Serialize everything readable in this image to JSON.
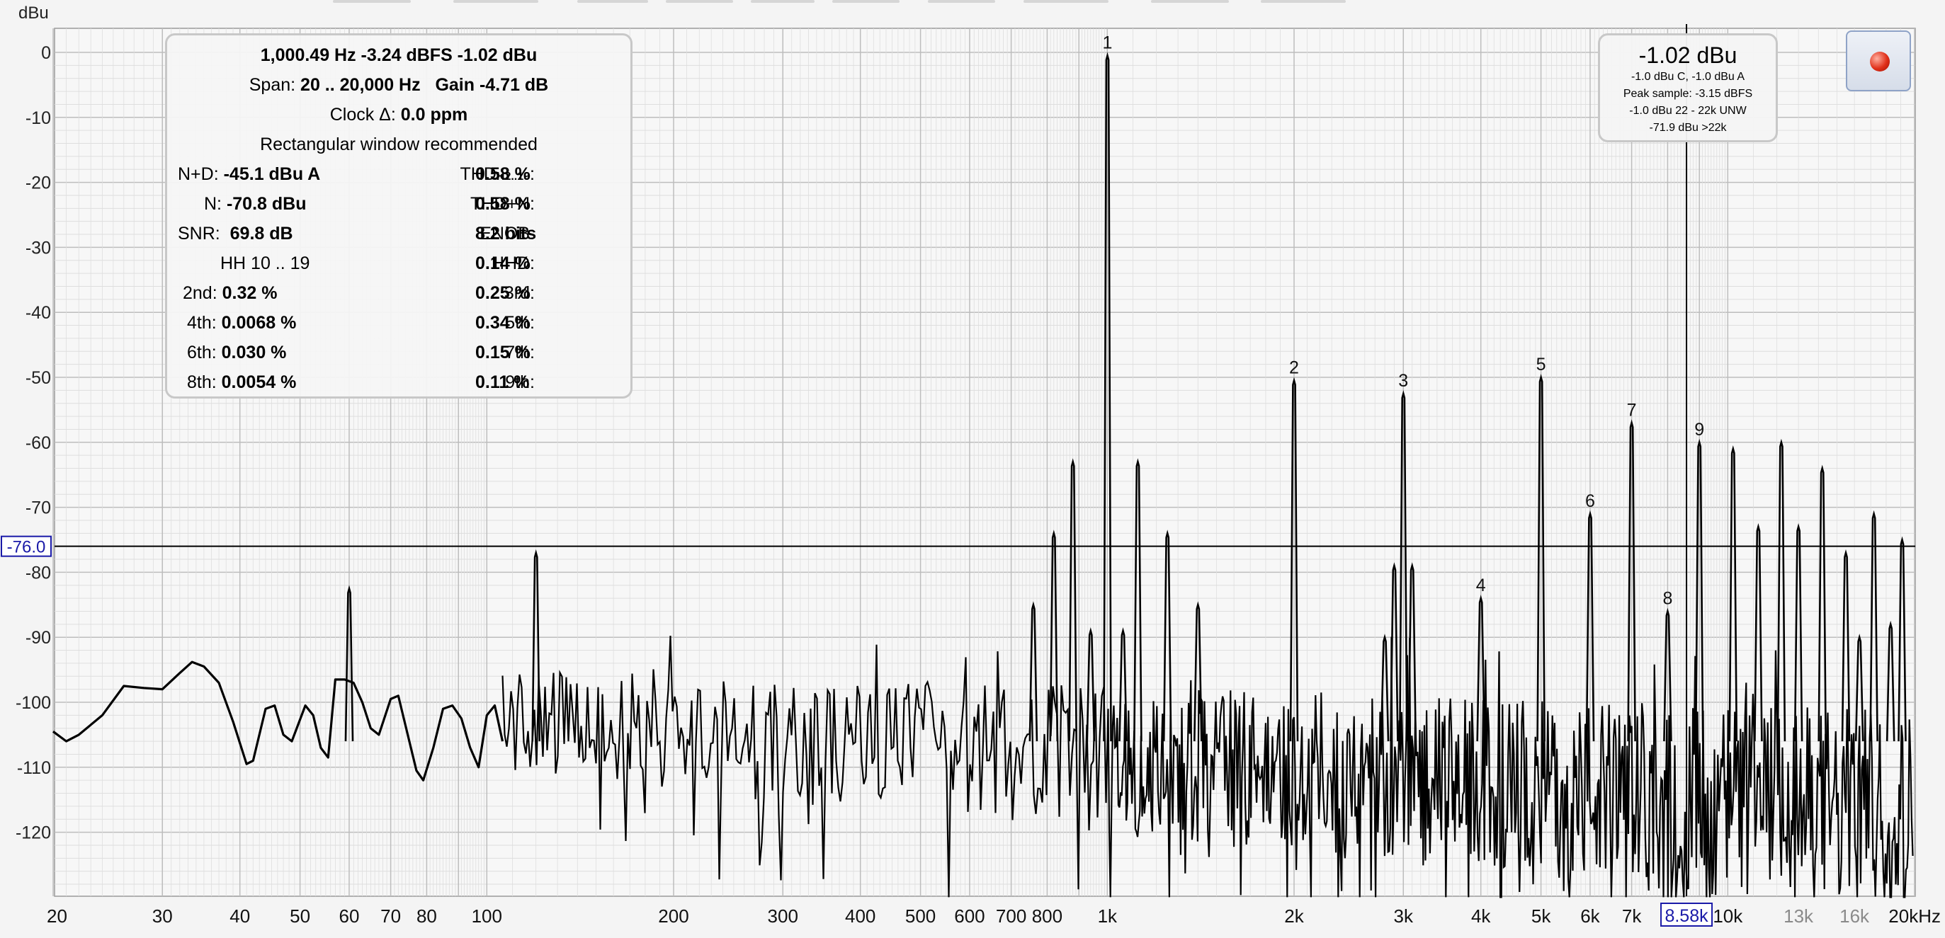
{
  "chart_data": {
    "type": "line",
    "ylabel": "dBu",
    "xscale": "log",
    "xlim": [
      20,
      20000
    ],
    "ylim": [
      -130,
      0
    ],
    "xticks": [
      {
        "v": 20,
        "label": "20"
      },
      {
        "v": 30,
        "label": "30"
      },
      {
        "v": 40,
        "label": "40"
      },
      {
        "v": 50,
        "label": "50"
      },
      {
        "v": 60,
        "label": "60"
      },
      {
        "v": 70,
        "label": "70"
      },
      {
        "v": 80,
        "label": "80"
      },
      {
        "v": 100,
        "label": "100"
      },
      {
        "v": 200,
        "label": "200"
      },
      {
        "v": 300,
        "label": "300"
      },
      {
        "v": 400,
        "label": "400"
      },
      {
        "v": 500,
        "label": "500"
      },
      {
        "v": 600,
        "label": "600"
      },
      {
        "v": 700,
        "label": "700"
      },
      {
        "v": 800,
        "label": "800"
      },
      {
        "v": 1000,
        "label": "1k"
      },
      {
        "v": 2000,
        "label": "2k"
      },
      {
        "v": 3000,
        "label": "3k"
      },
      {
        "v": 4000,
        "label": "4k"
      },
      {
        "v": 5000,
        "label": "5k"
      },
      {
        "v": 6000,
        "label": "6k"
      },
      {
        "v": 7000,
        "label": "7k"
      },
      {
        "v": 10000,
        "label": "10k"
      },
      {
        "v": 13000,
        "label": "13k",
        "dim": true
      },
      {
        "v": 16000,
        "label": "16k",
        "dim": true
      },
      {
        "v": 20000,
        "label": "20kHz"
      }
    ],
    "yticks": [
      0,
      -10,
      -20,
      -30,
      -40,
      -50,
      -60,
      -70,
      -80,
      -90,
      -100,
      -110,
      -120
    ],
    "cursor_x": {
      "v": 8580,
      "label": "8.58k"
    },
    "cursor_y": {
      "v": -76.0,
      "label": "-76.0"
    },
    "harmonics": [
      {
        "n": "1",
        "f": 1000.49,
        "db": -0.5
      },
      {
        "n": "2",
        "f": 2000,
        "db": -50.5
      },
      {
        "n": "3",
        "f": 3000,
        "db": -52.5
      },
      {
        "n": "4",
        "f": 4000,
        "db": -84.0
      },
      {
        "n": "5",
        "f": 5000,
        "db": -50.0
      },
      {
        "n": "6",
        "f": 6000,
        "db": -71.0
      },
      {
        "n": "7",
        "f": 7000,
        "db": -57.0
      },
      {
        "n": "8",
        "f": 8000,
        "db": -86.0
      },
      {
        "n": "9",
        "f": 9000,
        "db": -60.0
      }
    ],
    "spurs": [
      {
        "f": 120,
        "db": -77
      },
      {
        "f": 60,
        "db": -82.5
      },
      {
        "f": 760,
        "db": -85
      },
      {
        "f": 820,
        "db": -74
      },
      {
        "f": 880,
        "db": -63
      },
      {
        "f": 1120,
        "db": -63
      },
      {
        "f": 1250,
        "db": -74
      },
      {
        "f": 1400,
        "db": -85
      },
      {
        "f": 940,
        "db": -89
      },
      {
        "f": 1060,
        "db": -89
      },
      {
        "f": 2900,
        "db": -79
      },
      {
        "f": 3100,
        "db": -79
      },
      {
        "f": 2800,
        "db": -90
      },
      {
        "f": 10200,
        "db": -61
      },
      {
        "f": 11200,
        "db": -73
      },
      {
        "f": 12200,
        "db": -60
      },
      {
        "f": 13000,
        "db": -73
      },
      {
        "f": 14200,
        "db": -64
      },
      {
        "f": 15500,
        "db": -77
      },
      {
        "f": 17200,
        "db": -71
      },
      {
        "f": 19100,
        "db": -75
      },
      {
        "f": 18300,
        "db": -88
      },
      {
        "f": 16300,
        "db": -90
      }
    ],
    "low_curve": [
      [
        20,
        -104.5
      ],
      [
        21,
        -106
      ],
      [
        22,
        -105
      ],
      [
        24,
        -102
      ],
      [
        26,
        -97.5
      ],
      [
        28,
        -97.8
      ],
      [
        30,
        -98
      ],
      [
        32,
        -95.5
      ],
      [
        33.5,
        -93.8
      ],
      [
        35,
        -94.5
      ],
      [
        37,
        -97
      ],
      [
        39,
        -103
      ],
      [
        41,
        -109.5
      ],
      [
        42,
        -109
      ],
      [
        44,
        -101
      ],
      [
        45.5,
        -100.5
      ],
      [
        47,
        -105
      ],
      [
        48.5,
        -106
      ],
      [
        51,
        -100.5
      ],
      [
        52.5,
        -102
      ],
      [
        54,
        -107
      ],
      [
        55.5,
        -108.5
      ],
      [
        57,
        -96.5
      ],
      [
        59,
        -96.5
      ],
      [
        61,
        -97
      ],
      [
        63,
        -100
      ],
      [
        65,
        -104
      ],
      [
        67,
        -105
      ],
      [
        70,
        -99.5
      ],
      [
        72,
        -99
      ],
      [
        75,
        -106
      ],
      [
        77,
        -110.5
      ],
      [
        79,
        -112
      ],
      [
        82,
        -107
      ],
      [
        85,
        -101
      ],
      [
        88,
        -100.5
      ],
      [
        91,
        -102.5
      ],
      [
        94,
        -107
      ],
      [
        97,
        -110
      ],
      [
        100,
        -102
      ],
      [
        103,
        -100.5
      ],
      [
        106,
        -106
      ]
    ]
  },
  "panel": {
    "line1": "1,000.49 Hz   -3.24 dBFS   -1.02 dBu",
    "span_label": "Span:",
    "span_value": "20 .. 20,000 Hz",
    "gain_label": "Gain",
    "gain_value": "-4.71 dB",
    "clock_label": "Clock Δ:",
    "clock_value": "0.0 ppm",
    "window_note": "Rectangular window recommended",
    "nd_label": "N+D:",
    "nd_value": "-45.1 dBu A",
    "thd_label": "THD",
    "thd_sub": "H2..19",
    "thd_colon": ":",
    "thd_value": "0.58 %",
    "n_label": "N:",
    "n_value": "-70.8 dBu",
    "thdn_label": "THD+N:",
    "thdn_value": "0.58 %",
    "snr_label": "SNR:",
    "snr_value": "69.8 dB",
    "enob_label": "ENOB:",
    "enob_value": "8.2 bits",
    "hh_label": "HH 10 .. 19",
    "hhd_label": "HHD:",
    "hhd_value": "0.14 %",
    "h2_label": "2nd:",
    "h2_value": "0.32 %",
    "h3_label": "3rd:",
    "h3_value": "0.25 %",
    "h4_label": "4th:",
    "h4_value": "0.0068 %",
    "h5_label": "5th:",
    "h5_value": "0.34 %",
    "h6_label": "6th:",
    "h6_value": "0.030 %",
    "h7_label": "7th:",
    "h7_value": "0.15 %",
    "h8_label": "8th:",
    "h8_value": "0.0054 %",
    "h9_label": "9th:",
    "h9_value": "0.11 %"
  },
  "meter": {
    "main": "-1.02 dBu",
    "line1": "-1.0 dBu C, -1.0 dBu A",
    "line2": "Peak sample: -3.15 dBFS",
    "line3": "-1.0 dBu 22 - 22k UNW",
    "line4": "-71.9 dBu >22k"
  },
  "colors": {
    "trace": "#000000",
    "cursor_box": "#1a1aa8",
    "grid_major": "#bdbdbd",
    "grid_minor": "#dedede",
    "background": "#f4f4f4"
  }
}
